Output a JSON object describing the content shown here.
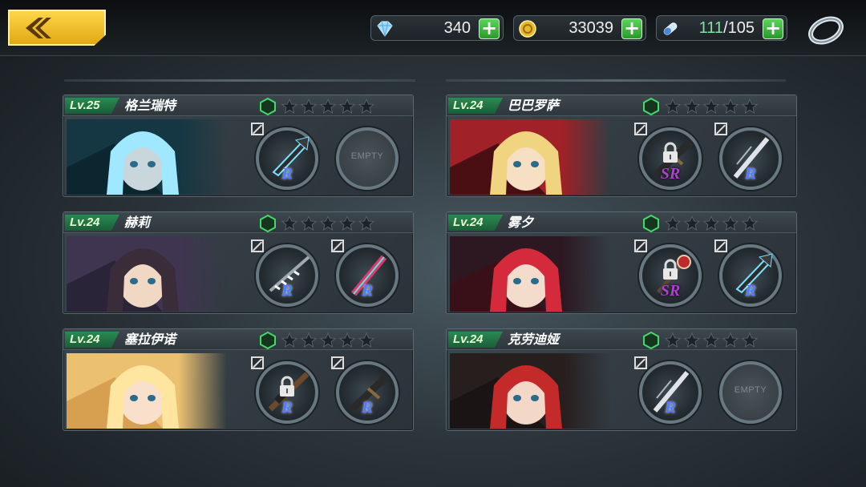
{
  "header": {
    "gems": "340",
    "gold": "33039",
    "stamina_current": "111",
    "stamina_max": "/105"
  },
  "icons": {
    "back": "back-arrow-icon",
    "gem": "diamond-icon",
    "gold": "gold-coin-icon",
    "stamina": "capsule-icon",
    "plus": "plus-icon",
    "ring": "ring-icon",
    "star": "star-icon",
    "lock": "lock-icon",
    "edit": "edit-icon"
  },
  "colors": {
    "accent_yellow": "#f5c22c",
    "level_green": "#2a8a52",
    "rarity_r": "#4a7dff",
    "rarity_sr": "#b040d0"
  },
  "plus_label": "+",
  "characters": [
    {
      "level": "Lv.25",
      "name": "格兰瑞特",
      "stars": 0,
      "slot1": {
        "rarity": "R",
        "locked": false
      },
      "slot2": {
        "empty": true,
        "label": "EMPTY"
      }
    },
    {
      "level": "Lv.24",
      "name": "巴巴罗萨",
      "stars": 0,
      "slot1": {
        "rarity": "SR",
        "locked": true
      },
      "slot2": {
        "rarity": "R",
        "locked": false
      }
    },
    {
      "level": "Lv.24",
      "name": "赫莉",
      "stars": 0,
      "slot1": {
        "rarity": "R",
        "locked": false
      },
      "slot2": {
        "rarity": "R",
        "locked": false
      }
    },
    {
      "level": "Lv.24",
      "name": "雾夕",
      "stars": 0,
      "slot1": {
        "rarity": "SR",
        "locked": true
      },
      "slot2": {
        "rarity": "R",
        "locked": false
      }
    },
    {
      "level": "Lv.24",
      "name": "塞拉伊诺",
      "stars": 0,
      "slot1": {
        "rarity": "R",
        "locked": true
      },
      "slot2": {
        "rarity": "R",
        "locked": false
      }
    },
    {
      "level": "Lv.24",
      "name": "克劳迪娅",
      "stars": 0,
      "slot1": {
        "rarity": "R",
        "locked": false
      },
      "slot2": {
        "empty": true,
        "label": "EMPTY"
      }
    }
  ]
}
